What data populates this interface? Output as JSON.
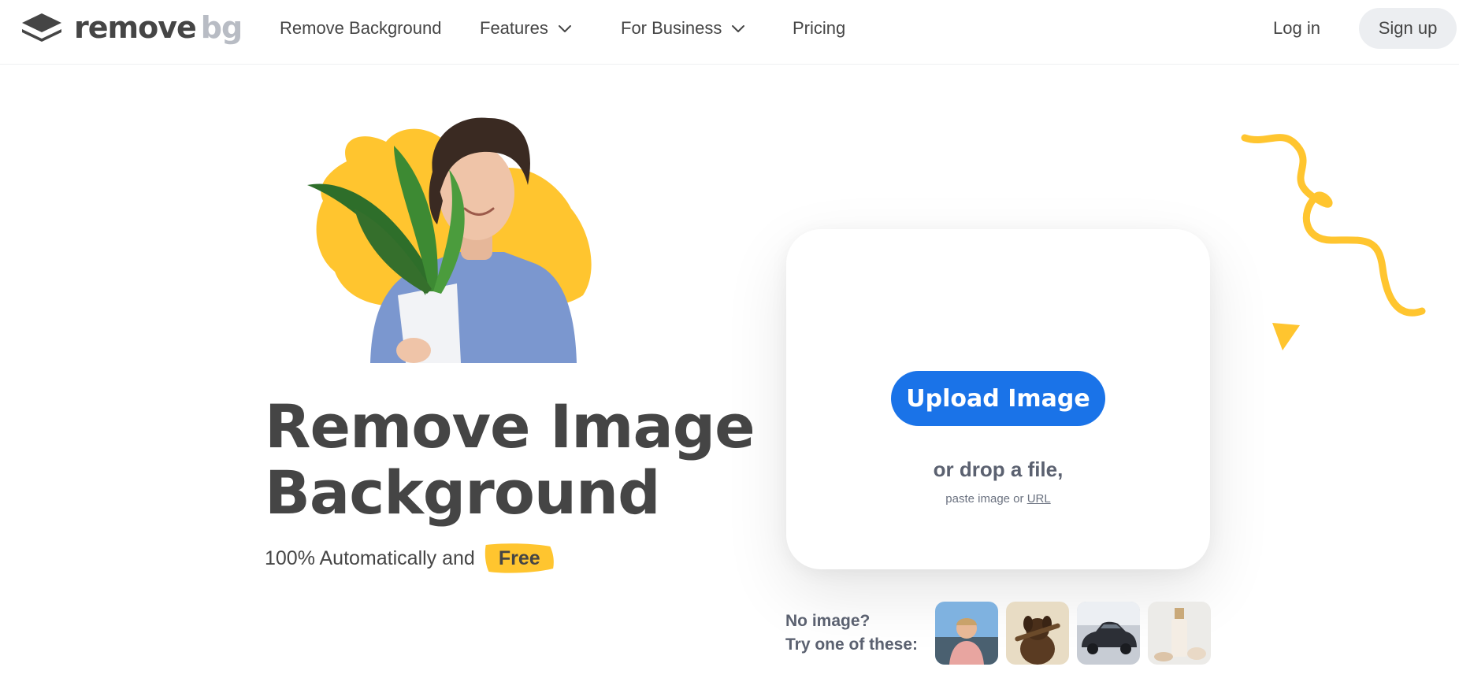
{
  "nav": {
    "logo_main": "remove",
    "logo_suffix": "bg",
    "links": [
      {
        "label": "Remove Background"
      },
      {
        "label": "Features"
      },
      {
        "label": "For Business"
      },
      {
        "label": "Pricing"
      }
    ],
    "login_label": "Log in",
    "signup_label": "Sign up"
  },
  "hero": {
    "headline_line1": "Remove Image",
    "headline_line2": "Background",
    "subline_text": "100% Automatically and",
    "subline_badge": "Free",
    "image_icon": "person-holding-plant-photo"
  },
  "upload": {
    "button_label": "Upload Image",
    "drop_text": "or drop a file,",
    "paste_prefix": "paste image or",
    "paste_link": "URL"
  },
  "samples": {
    "line1": "No image?",
    "line2": "Try one of these:",
    "items": [
      {
        "icon": "person-sample-thumbnail"
      },
      {
        "icon": "dog-sample-thumbnail"
      },
      {
        "icon": "car-sample-thumbnail"
      },
      {
        "icon": "cosmetics-sample-thumbnail"
      }
    ]
  },
  "colors": {
    "accent_blue": "#1a73e8",
    "brand_yellow": "#ffc52f",
    "text_dark": "#454545",
    "logo_grey": "#b8bcc4"
  }
}
